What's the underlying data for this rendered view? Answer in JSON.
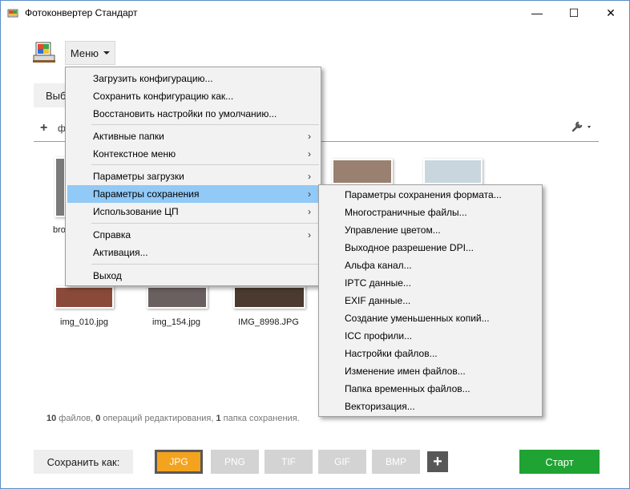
{
  "window": {
    "title": "Фотоконвертер Стандарт",
    "minimize_glyph": "—",
    "maximize_glyph": "☐",
    "close_glyph": "✕"
  },
  "menu_button": {
    "label": "Меню"
  },
  "tab_partial": {
    "label": "Выб"
  },
  "toolbar": {
    "add_partial_label": "ф"
  },
  "thumbnails": [
    {
      "label": "bro",
      "color": "#7a7a7a"
    },
    {
      "label": "img_010.jpg",
      "color": "#8a4a3a"
    },
    {
      "label": "img_154.jpg",
      "color": "#6a6060"
    },
    {
      "label": "IMG_8998.JPG",
      "color": "#4a3a30"
    }
  ],
  "status": {
    "files_count": "10",
    "files_text": " файлов, ",
    "ops_count": "0",
    "ops_text": " операций редактирования, ",
    "folders_count": "1",
    "folders_text": " папка сохранения."
  },
  "save_as": {
    "label": "Сохранить как:"
  },
  "formats": [
    {
      "label": "JPG",
      "active": true
    },
    {
      "label": "PNG",
      "active": false
    },
    {
      "label": "TIF",
      "active": false
    },
    {
      "label": "GIF",
      "active": false
    },
    {
      "label": "BMP",
      "active": false
    }
  ],
  "add_format": {
    "label": "+"
  },
  "start_button": {
    "label": "Старт"
  },
  "dropdown": {
    "items": [
      {
        "label": "Загрузить конфигурацию...",
        "arrow": ""
      },
      {
        "label": "Сохранить конфигурацию как...",
        "arrow": ""
      },
      {
        "label": "Восстановить настройки по умолчанию...",
        "arrow": ""
      },
      {
        "label": "Активные папки",
        "arrow": "›"
      },
      {
        "label": "Контекстное меню",
        "arrow": "›"
      },
      {
        "label": "Параметры загрузки",
        "arrow": "›"
      },
      {
        "label": "Параметры сохранения",
        "arrow": "›"
      },
      {
        "label": "Использование ЦП",
        "arrow": "›"
      },
      {
        "label": "Справка",
        "arrow": "›"
      },
      {
        "label": "Активация...",
        "arrow": ""
      },
      {
        "label": "Выход",
        "arrow": ""
      }
    ]
  },
  "submenu": {
    "items": [
      "Параметры сохранения формата...",
      "Многостраничные файлы...",
      "Управление цветом...",
      "Выходное разрешение DPI...",
      "Альфа канал...",
      "IPTC данные...",
      "EXIF данные...",
      "Создание уменьшенных копий...",
      "ICC профили...",
      "Настройки файлов...",
      "Изменение имен файлов...",
      "Папка временных файлов...",
      "Векторизация..."
    ]
  },
  "colors": {
    "accent_format": "#f4a31f",
    "start_green": "#1fa333",
    "menu_highlight": "#91c9f7"
  }
}
